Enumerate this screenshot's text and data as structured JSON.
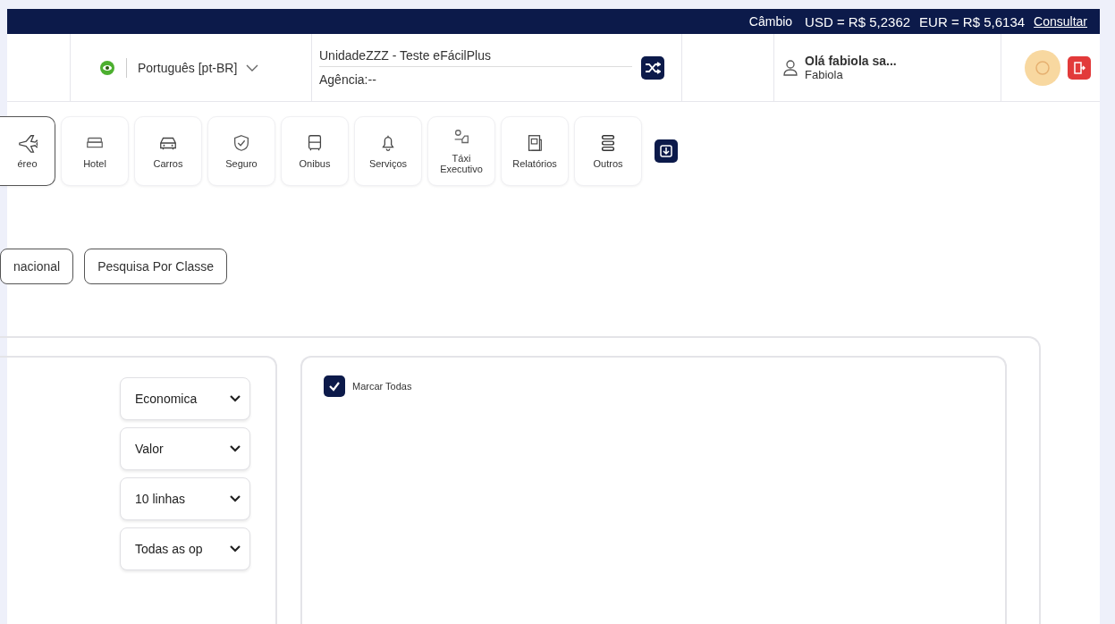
{
  "exchange_bar": {
    "label": "Câmbio",
    "rates": [
      "USD = R$ 5,2362",
      "EUR = R$ 5,6134"
    ],
    "link": "Consultar"
  },
  "header": {
    "language": "Português [pt-BR]",
    "unit": "UnidadeZZZ - Teste eFácilPlus",
    "agency": "Agência:--",
    "greeting": "Olá fabiola sa...",
    "user": "Fabiola"
  },
  "services": [
    {
      "label": "éreo",
      "kind": "plane",
      "selected": true
    },
    {
      "label": "Hotel",
      "kind": "bed",
      "selected": false
    },
    {
      "label": "Carros",
      "kind": "car",
      "selected": false
    },
    {
      "label": "Seguro",
      "kind": "shield",
      "selected": false
    },
    {
      "label": "Onibus",
      "kind": "bus",
      "selected": false
    },
    {
      "label": "Serviços",
      "kind": "bell",
      "selected": false
    },
    {
      "label": "Táxi Executivo",
      "kind": "taxi",
      "selected": false
    },
    {
      "label": "Relatórios",
      "kind": "report",
      "selected": false
    },
    {
      "label": "Outros",
      "kind": "stack",
      "selected": false
    }
  ],
  "search_buttons": [
    "nacional",
    "Pesquisa Por Classe"
  ],
  "filters": [
    "Economica",
    "Valor",
    "10 linhas",
    "Todas as op"
  ],
  "mark_all": {
    "label": "Marcar Todas",
    "checked": true
  }
}
